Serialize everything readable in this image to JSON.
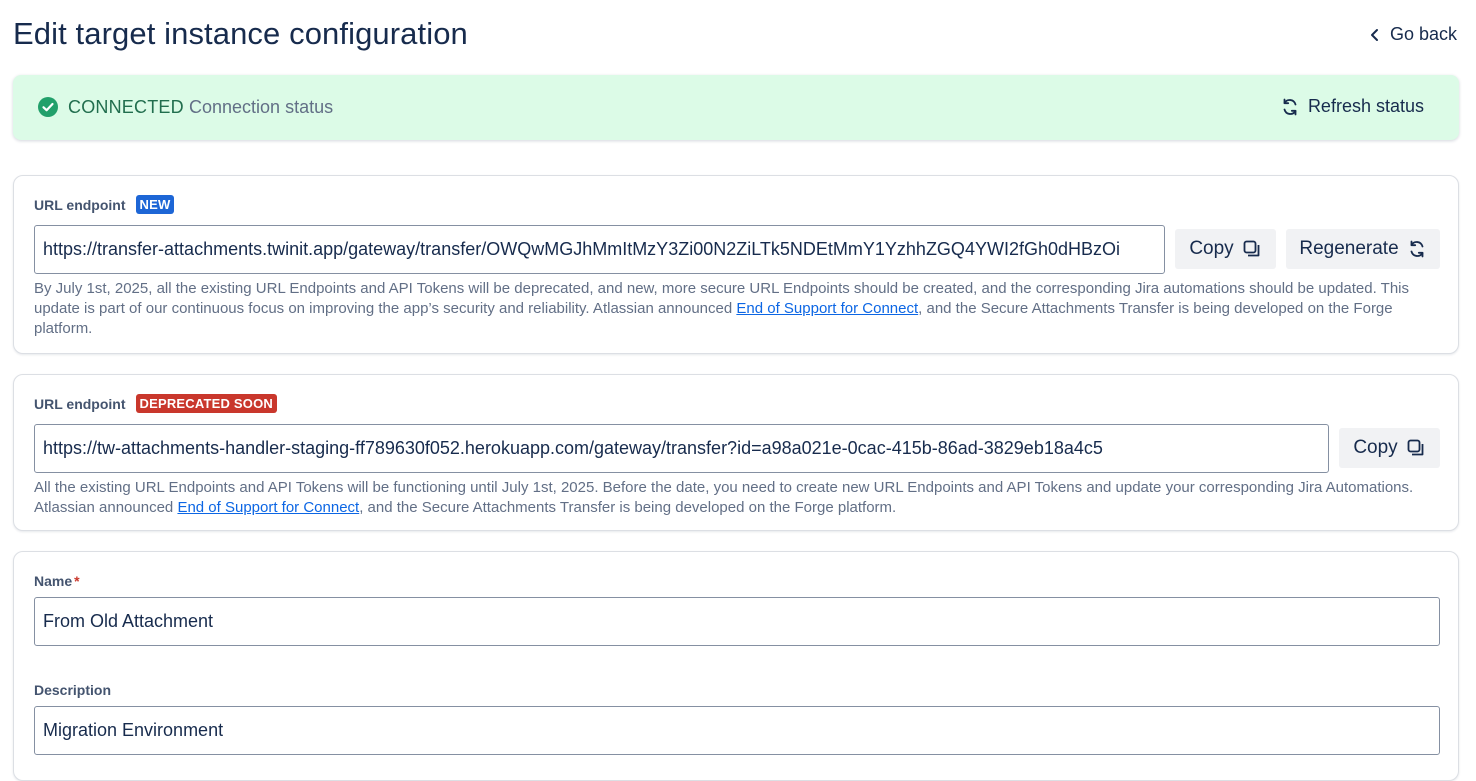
{
  "header": {
    "title": "Edit target instance configuration",
    "go_back": "Go back"
  },
  "status": {
    "label": "CONNECTED",
    "description": "Connection status",
    "refresh_label": "Refresh status",
    "color": "#22a06b"
  },
  "new_endpoint": {
    "label": "URL endpoint",
    "badge": "NEW",
    "value": "https://transfer-attachments.twinit.app/gateway/transfer/OWQwMGJhMmItMzY3Zi00N2ZiLTk5NDEtMmY1YzhhZGQ4YWI2fGh0dHBzOi",
    "copy_label": "Copy",
    "regenerate_label": "Regenerate",
    "help_before": "By July 1st, 2025, all the existing URL Endpoints and API Tokens will be deprecated, and new, more secure URL Endpoints should be created, and the corresponding Jira automations should be updated. This update is part of our continuous focus on improving the app’s security and reliability. Atlassian announced ",
    "help_link": "End of Support for Connect",
    "help_after": ", and the Secure Attachments Transfer is being developed on the Forge platform."
  },
  "old_endpoint": {
    "label": "URL endpoint",
    "badge": "DEPRECATED SOON",
    "value": "https://tw-attachments-handler-staging-ff789630f052.herokuapp.com/gateway/transfer?id=a98a021e-0cac-415b-86ad-3829eb18a4c5",
    "copy_label": "Copy",
    "help_before": "All the existing URL Endpoints and API Tokens will be functioning until July 1st, 2025. Before the date, you need to create new URL Endpoints and API Tokens and update your corresponding Jira Automations. Atlassian announced ",
    "help_link": "End of Support for Connect",
    "help_after": ", and the Secure Attachments Transfer is being developed on the Forge platform."
  },
  "form": {
    "name_label": "Name",
    "name_required": "*",
    "name_value": "From Old Attachment",
    "description_label": "Description",
    "description_value": "Migration Environment"
  }
}
